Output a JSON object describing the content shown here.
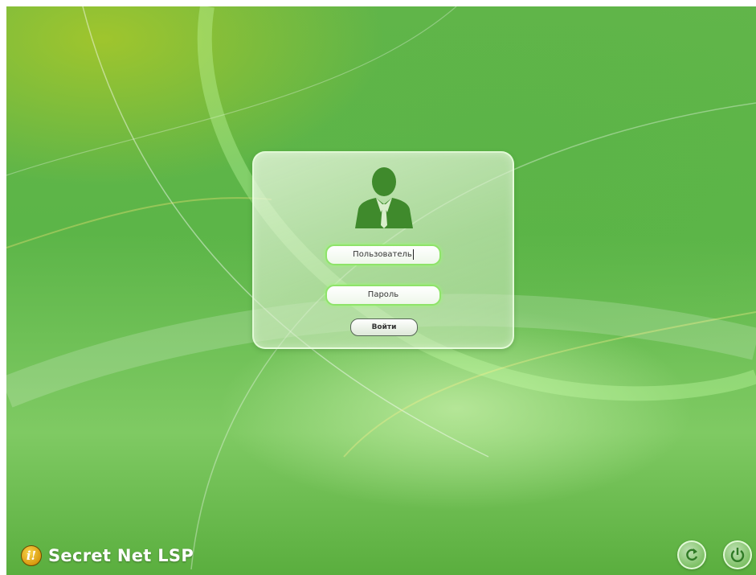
{
  "login": {
    "username_value": "Пользователь",
    "password_placeholder": "Пароль",
    "submit_label": "Войти"
  },
  "branding": {
    "logo_glyph": "i!",
    "product_name": "Secret Net LSP"
  },
  "icons": {
    "user": "user-silhouette-icon",
    "restart": "restart-icon",
    "power": "power-icon"
  },
  "colors": {
    "background": "#5cb548",
    "field_glow": "#8fe36a",
    "icon_green": "#3f8a2c"
  }
}
